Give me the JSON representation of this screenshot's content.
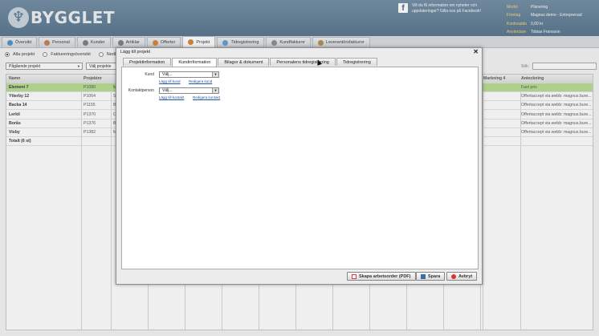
{
  "header": {
    "logo_text": "BYGGLET",
    "facebook_text": "Vill du få information om nyheter och uppdateringar? Gilla oss på Facebook!",
    "info": [
      {
        "key": "Modul",
        "value": "Planering"
      },
      {
        "key": "Företag",
        "value": "Magnus demo - Entreprenad"
      },
      {
        "key": "Kontosaldo",
        "value": "0,00 kr"
      },
      {
        "key": "Användare",
        "value": "Tobias Fransson"
      }
    ]
  },
  "nav": {
    "tabs": [
      {
        "label": "Översikt",
        "color": "#4a8fc7"
      },
      {
        "label": "Personal",
        "color": "#c77c4a"
      },
      {
        "label": "Kunder",
        "color": "#7a7a7a"
      },
      {
        "label": "Artiklar",
        "color": "#7a7a7a"
      },
      {
        "label": "Offerter",
        "color": "#d9822b"
      },
      {
        "label": "Projekt",
        "color": "#d9822b"
      },
      {
        "label": "Tidregistrering",
        "color": "#5a9bd5"
      },
      {
        "label": "Kundfakturor",
        "color": "#8a8a8a"
      },
      {
        "label": "Leverantörsfakturor",
        "color": "#b08a4a"
      }
    ],
    "active_tab": "Projekt"
  },
  "subnav": {
    "options": [
      "Alla projekt",
      "Faktureringsöversikt",
      "Nedl"
    ]
  },
  "filters": {
    "status_select": "Pågående projekt",
    "project_select": "Välj projekte"
  },
  "search": {
    "label": "Sök:"
  },
  "grid": {
    "headers": [
      "Namn",
      "Projektnr",
      "",
      "",
      "",
      "",
      "",
      "",
      "",
      "",
      "",
      "",
      "",
      "Markning 4",
      "Anteckning"
    ],
    "rows": [
      {
        "name": "Element 7",
        "projektnr": "P1080",
        "col3": "M",
        "note": "Fast pris"
      },
      {
        "name": "Ytterby 12",
        "projektnr": "P1064",
        "col3": "S",
        "note": "Offertaccept via webb: magnus.bure..."
      },
      {
        "name": "Backa 14",
        "projektnr": "P1155",
        "col3": "B",
        "note": "Offertaccept via webb: magnus.bure..."
      },
      {
        "name": "Lerkil",
        "projektnr": "P1370",
        "col3": "O",
        "note": "Offertaccept via webb: magnus.bure..."
      },
      {
        "name": "Borås",
        "projektnr": "P1376",
        "col3": "B",
        "note": "Offertaccept via webb: magnus.bure..."
      },
      {
        "name": "Visby",
        "projektnr": "P1382",
        "col3": "M",
        "note": "Offertaccept via webb: magnus.bure..."
      }
    ],
    "total": "Totalt (6 st)"
  },
  "dialog": {
    "title": "Lägg till projekt",
    "close": "✕",
    "tabs": [
      "Projektinformation",
      "Kundinformation",
      "Bilagor & dokument",
      "Personalens tidregistrering",
      "Tidregistrering"
    ],
    "active_tab": "Kundinformation",
    "kund_label": "Kund",
    "kund_value": "Välj...",
    "kund_add": "Lägg till kund",
    "kund_edit": "Redigera kund",
    "kontakt_label": "Kontaktperson",
    "kontakt_value": "Välj...",
    "kontakt_add": "Lägg till kontakt",
    "kontakt_edit": "Redigera kontakt",
    "btn_pdf": "Skapa arbetsorder (PDF)",
    "btn_save": "Spara",
    "btn_cancel": "Avbryt"
  }
}
